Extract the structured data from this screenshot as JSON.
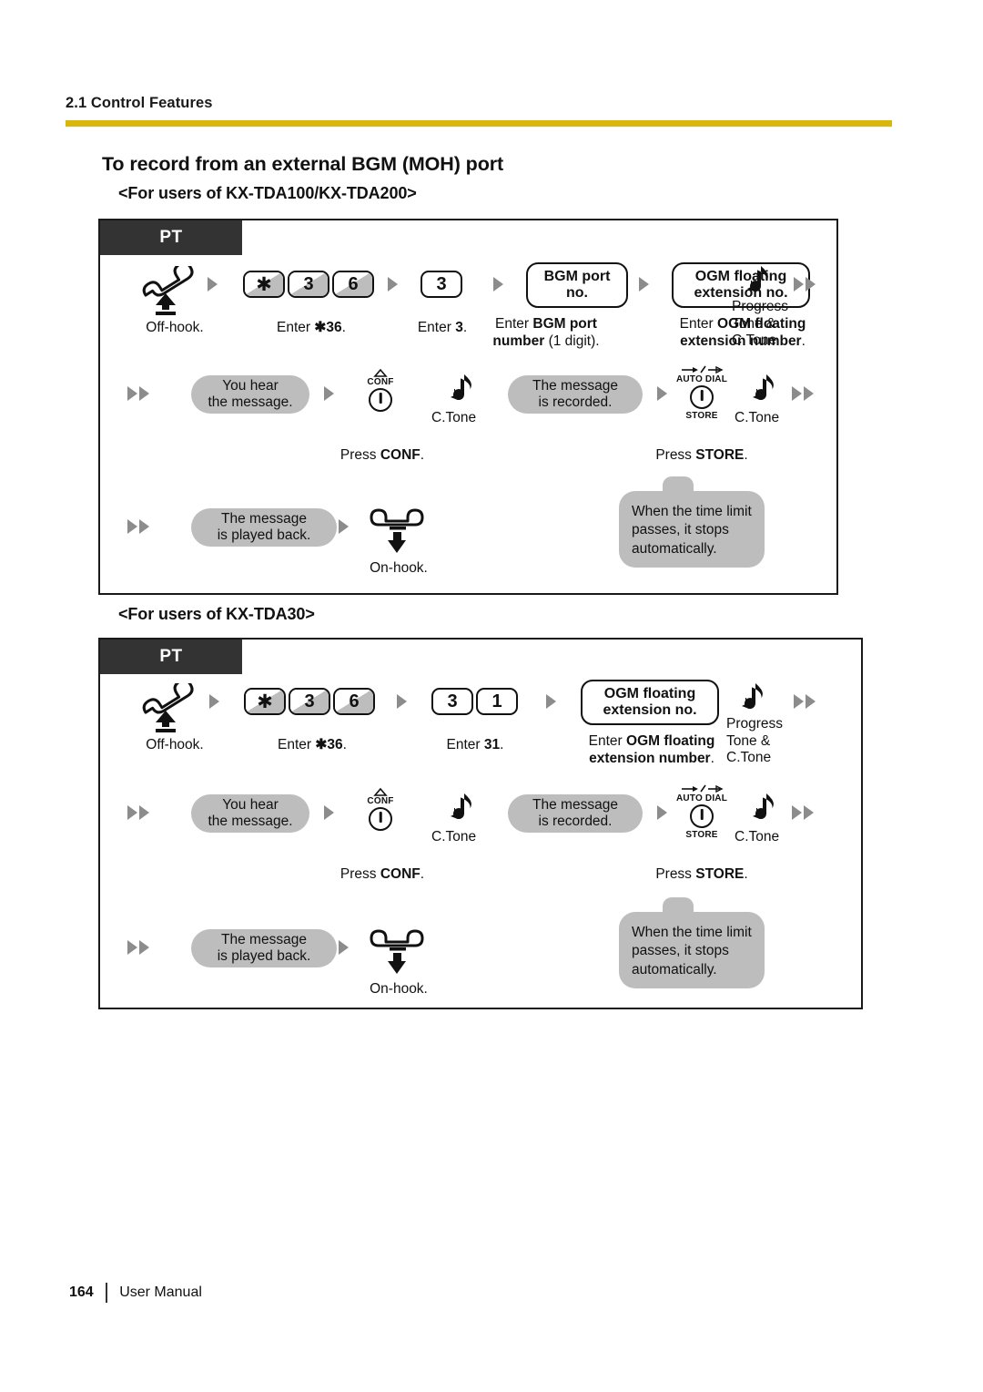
{
  "header": {
    "section": "2.1 Control Features",
    "rule_color": "#d8b70a"
  },
  "title": "To record from an external BGM (MOH) port",
  "subtitles": {
    "tda100_200": "<For users of KX-TDA100/KX-TDA200>",
    "tda30": "<For users of KX-TDA30>"
  },
  "badge": {
    "pt": "PT"
  },
  "icons": {
    "offhook": "handset-offhook-icon",
    "onhook": "handset-onhook-icon",
    "note": "music-note-icon",
    "arrow": "triangle-arrow-icon",
    "conf": "conf-button-icon",
    "store": "store-button-icon"
  },
  "diagram1": {
    "step_offhook_caption": "Off-hook.",
    "keys_feature": [
      "✱",
      "3",
      "6"
    ],
    "keys_feature_caption_prefix": "Enter ",
    "keys_feature_caption_bold": "✱36",
    "keys_feature_caption_suffix": ".",
    "key_three": "3",
    "key_three_caption_prefix": "Enter ",
    "key_three_caption_bold": "3",
    "key_three_caption_suffix": ".",
    "bgm_box_line1": "BGM port",
    "bgm_box_line2": "no.",
    "bgm_caption_prefix": "Enter ",
    "bgm_caption_bold": "BGM port",
    "bgm_caption_line2_bold": "number",
    "bgm_caption_line2_suffix": " (1 digit).",
    "ogm_box_line1": "OGM floating",
    "ogm_box_line2": "extension no.",
    "ogm_caption_prefix": "Enter ",
    "ogm_caption_bold": "OGM floating",
    "ogm_caption_line2_bold": "extension number",
    "ogm_caption_line2_suffix": ".",
    "progress_tone": "Progress\nTone &\nC.Tone",
    "pill_you_hear": "You hear\nthe message.",
    "conf_label_top": "CONF",
    "conf_caption_prefix": "Press ",
    "conf_caption_bold": "CONF",
    "conf_caption_suffix": ".",
    "ctone_1": "C.Tone",
    "pill_recorded": "The message\nis recorded.",
    "store_label_top": "AUTO DIAL",
    "store_label_bottom": "STORE",
    "store_caption_prefix": "Press ",
    "store_caption_bold": "STORE",
    "store_caption_suffix": ".",
    "ctone_2": "C.Tone",
    "pill_played_back": "The message\nis played back.",
    "onhook_caption": "On-hook.",
    "callout": "When the time limit passes, it stops automatically."
  },
  "diagram2": {
    "step_offhook_caption": "Off-hook.",
    "keys_feature": [
      "✱",
      "3",
      "6"
    ],
    "keys_feature_caption_prefix": "Enter ",
    "keys_feature_caption_bold": "✱36",
    "keys_feature_caption_suffix": ".",
    "keys_31": [
      "3",
      "1"
    ],
    "keys_31_caption_prefix": "Enter ",
    "keys_31_caption_bold": "31",
    "keys_31_caption_suffix": ".",
    "ogm_box_line1": "OGM floating",
    "ogm_box_line2": "extension no.",
    "ogm_caption_prefix": "Enter ",
    "ogm_caption_bold": "OGM floating",
    "ogm_caption_line2_bold": "extension number",
    "ogm_caption_line2_suffix": ".",
    "progress_tone": "Progress\nTone &\nC.Tone",
    "pill_you_hear": "You hear\nthe message.",
    "conf_label_top": "CONF",
    "conf_caption_prefix": "Press ",
    "conf_caption_bold": "CONF",
    "conf_caption_suffix": ".",
    "ctone_1": "C.Tone",
    "pill_recorded": "The message\nis recorded.",
    "store_label_top": "AUTO DIAL",
    "store_label_bottom": "STORE",
    "store_caption_prefix": "Press ",
    "store_caption_bold": "STORE",
    "store_caption_suffix": ".",
    "ctone_2": "C.Tone",
    "pill_played_back": "The message\nis played back.",
    "onhook_caption": "On-hook.",
    "callout": "When the time limit passes, it stops automatically."
  },
  "footer": {
    "page_number": "164",
    "label": "User Manual"
  }
}
